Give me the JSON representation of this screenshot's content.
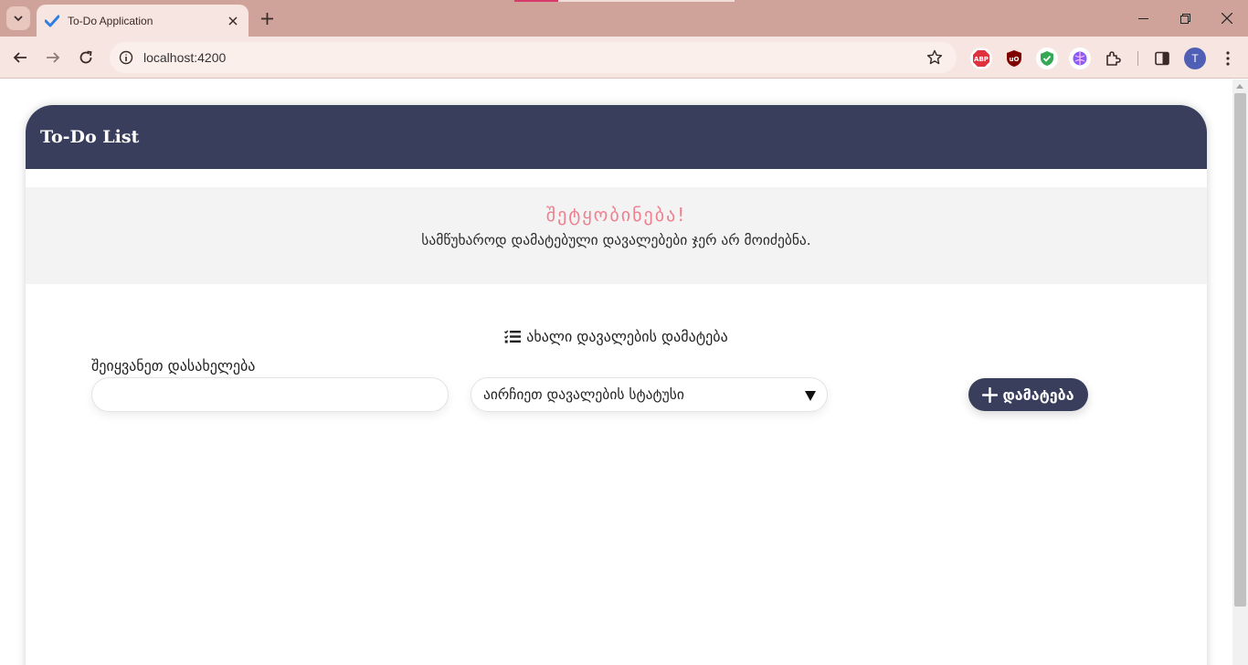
{
  "browser": {
    "tab_title": "To-Do Application",
    "url": "localhost:4200",
    "profile_initial": "T",
    "extensions": [
      "adblock-plus-icon",
      "ublock-origin-icon",
      "shield-check-icon",
      "brain-icon"
    ]
  },
  "app": {
    "header_title": "To-Do List",
    "notice": {
      "title": "შეტყობინება!",
      "text": "სამწუხაროდ დამატებული დავალებები ჯერ არ მოიძებნა."
    },
    "form": {
      "heading": "ახალი დავალების დამატება",
      "name_label": "შეიყვანეთ დასახელება",
      "name_value": "",
      "status_placeholder": "აირჩიეთ დავალების სტატუსი",
      "add_label": "დამატება"
    }
  },
  "colors": {
    "header_bg": "#393e5c",
    "notice_title": "#ef7f8e",
    "tabstrip_bg": "#cfa39a"
  }
}
